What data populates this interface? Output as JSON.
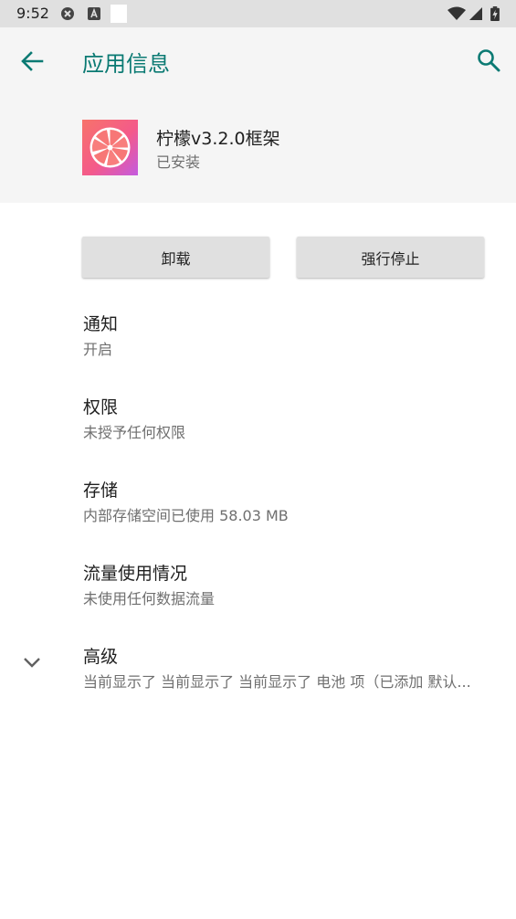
{
  "status_bar": {
    "time": "9:52",
    "icons": [
      "x-notification-icon",
      "a-notification-icon",
      "blank-notification-icon",
      "wifi-icon",
      "signal-icon",
      "battery-charging-icon"
    ]
  },
  "toolbar": {
    "title": "应用信息",
    "back_icon": "arrow-left-icon",
    "search_icon": "search-icon",
    "accent_color": "#0b7a73"
  },
  "app": {
    "name": "柠檬v3.2.0框架",
    "status": "已安装"
  },
  "buttons": {
    "uninstall": "卸载",
    "force_stop": "强行停止"
  },
  "preferences": [
    {
      "title": "通知",
      "summary": "开启"
    },
    {
      "title": "权限",
      "summary": "未授予任何权限"
    },
    {
      "title": "存储",
      "summary": "内部存储空间已使用 58.03 MB"
    },
    {
      "title": "流量使用情况",
      "summary": "未使用任何数据流量"
    },
    {
      "title": "高级",
      "summary": "当前显示了 当前显示了 当前显示了 电池 项（已添加 默认..."
    }
  ]
}
